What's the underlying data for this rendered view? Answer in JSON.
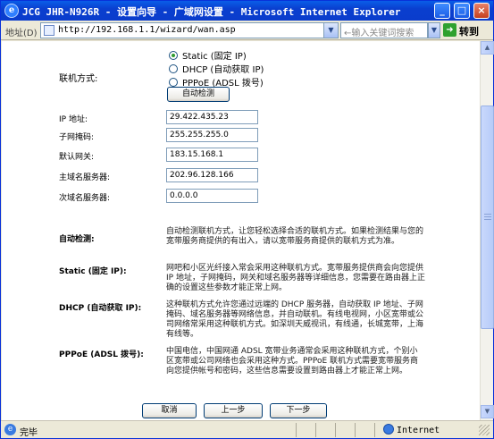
{
  "window": {
    "title": "JCG JHR-N926R - 设置向导 - 广域网设置 - Microsoft Internet Explorer",
    "app_letter": "e"
  },
  "address_bar": {
    "label": "地址(D)",
    "url": "http://192.168.1.1/wizard/wan.asp",
    "search_placeholder": "←输入关键词搜索",
    "go_label": "转到"
  },
  "form": {
    "connection_label": "联机方式:",
    "connection_options": [
      {
        "label": "Static (固定 IP)",
        "checked": true
      },
      {
        "label": "DHCP (自动获取 IP)",
        "checked": false
      },
      {
        "label": "PPPoE (ADSL 拨号)",
        "checked": false
      }
    ],
    "auto_detect_button": "自动检测",
    "fields": [
      {
        "label": "IP 地址:",
        "value": "29.422.435.23"
      },
      {
        "label": "子网掩码:",
        "value": "255.255.255.0"
      },
      {
        "label": "默认网关:",
        "value": "183.15.168.1"
      },
      {
        "label": "主域名服务器:",
        "value": "202.96.128.166"
      },
      {
        "label": "次域名服务器:",
        "value": "0.0.0.0"
      }
    ]
  },
  "help": [
    {
      "term": "自动检测:",
      "desc": "自动检测联机方式，让您轻松选择合适的联机方式。如果检测结果与您的宽带服务商提供的有出入，请以宽带服务商提供的联机方式为准。"
    },
    {
      "term": "Static (固定 IP):",
      "desc": "网吧和小区光纤接入常会采用这种联机方式。宽带服务提供商会向您提供 IP 地址，子网掩码，网关和域名服务器等详细信息，您需要在路由器上正确的设置这些参数才能正常上网。"
    },
    {
      "term": "DHCP (自动获取 IP):",
      "desc": "这种联机方式允许您通过远端的 DHCP 服务器，自动获取 IP 地址、子网掩码、域名服务器等网络信息，并自动联机。有线电视网，小区宽带或公司网络常采用这种联机方式。如深圳天威视讯，有线通，长城宽带，上海有线等。"
    },
    {
      "term": "PPPoE (ADSL 拨号):",
      "desc": "中国电信，中国网通 ADSL 宽带业务通常会采用这种联机方式，个别小区宽带或公司网络也会采用这种方式。PPPoE 联机方式需要宽带服务商向您提供帐号和密码，这些信息需要设置到路由器上才能正常上网。"
    }
  ],
  "nav_buttons": {
    "cancel": "取消",
    "prev": "上一步",
    "next": "下一步"
  },
  "status_bar": {
    "text": "完毕",
    "zone": "Internet"
  },
  "icons": {
    "minimize": "minimize-icon",
    "maximize": "maximize-icon",
    "close": "close-icon",
    "go": "go-arrow-icon",
    "globe": "internet-zone-icon"
  }
}
